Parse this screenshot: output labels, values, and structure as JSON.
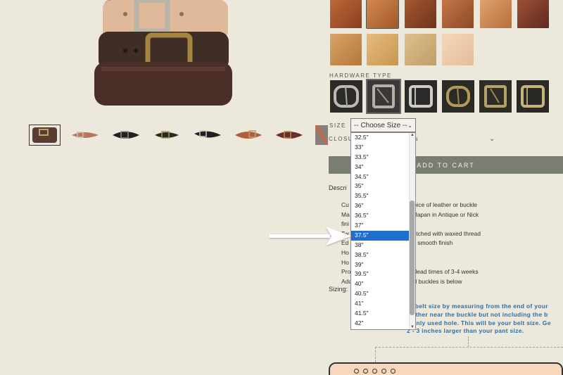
{
  "hardware": {
    "label": "HARDWARE TYPE"
  },
  "size": {
    "label": "SIZE",
    "selected": "-- Choose Size --",
    "options": [
      "32.5\"",
      "33\"",
      "33.5\"",
      "34\"",
      "34.5\"",
      "35\"",
      "35.5\"",
      "36\"",
      "36.5\"",
      "37\"",
      "37.5\"",
      "38\"",
      "38.5\"",
      "39\"",
      "39.5\"",
      "40\"",
      "40.5\"",
      "41\"",
      "41.5\"",
      "42\""
    ],
    "highlighted": "37.5\""
  },
  "closure": {
    "label": "CLOSU",
    "value_fragment": "ts"
  },
  "cart": {
    "button": "ADD TO CART"
  },
  "description": {
    "title": "Descri",
    "bullets": [
      "Cu                  \") wide belt with your choice of leather or buckle",
      "Ma                  olid brass buckles from Japan in Antique or Nick",
      "fini",
      "Tw                  d brass rivets or hand-stitched with waxed thread",
      "Ed                  ished with beeswax for a smooth finish",
      "Ho                  a perfect fit",
      "Ho                  ta",
      "Pro                 r and follows the stated lead times of 3-4 weeks",
      "Add                 n available leathers and buckles is below"
    ]
  },
  "sizing": {
    "label": "Sizing:",
    "note": [
      "ur belt size by measuring from the end of your",
      "leather near the buckle but not including the b",
      "monly used hole. This will be your belt size. Ge",
      "2 - 3 inches larger than your pant size."
    ]
  },
  "colors": {
    "background": "#ede8dc",
    "cart_button": "#7a7d72",
    "highlight": "#1f6fd1",
    "sizing_note": "#2a6fa6",
    "belt_diagram": "#f7d8bd"
  },
  "icons": [
    "chevron-down-icon",
    "arrow-right-icon",
    "scroll-up-icon",
    "scroll-down-icon"
  ]
}
